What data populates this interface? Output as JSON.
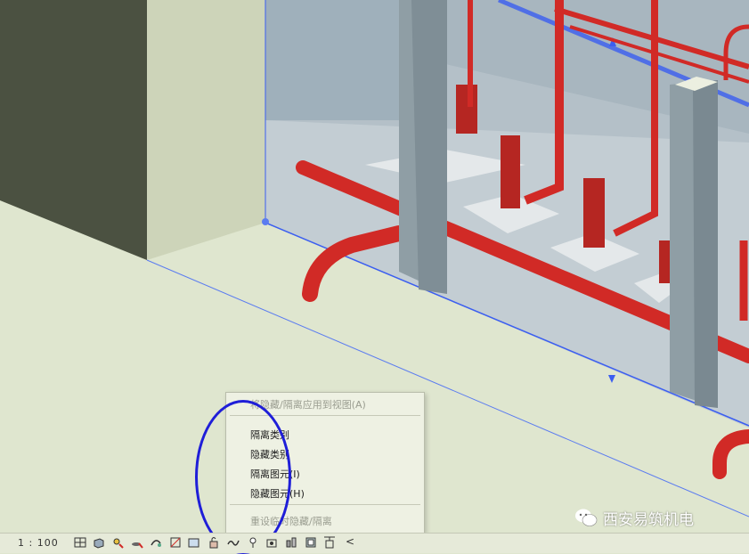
{
  "context_menu": {
    "items": [
      {
        "label": "将隐藏/隔离应用到视图(A)",
        "enabled": false
      },
      {
        "label": "隔离类别",
        "enabled": true
      },
      {
        "label": "隐藏类别",
        "enabled": true
      },
      {
        "label": "隔离图元(I)",
        "enabled": true
      },
      {
        "label": "隐藏图元(H)",
        "enabled": true
      },
      {
        "label": "重设临时隐藏/隔离",
        "enabled": false
      }
    ]
  },
  "status_bar": {
    "scale": "1 : 100",
    "chevron": "<",
    "icons": [
      "detail-level-icon",
      "visual-style-icon",
      "sun-path-off-icon",
      "shadows-off-icon",
      "render-icon",
      "crop-view-icon",
      "show-crop-icon",
      "unlock-3d-icon",
      "temporary-hide-isolate-icon",
      "reveal-hidden-icon",
      "pin-icon",
      "worksharing-icon",
      "analysis-display-icon",
      "highlight-displacement-icon",
      "design-options-icon",
      "constraints-icon"
    ]
  },
  "watermark": {
    "text": "西安易筑机电"
  },
  "colors": {
    "pipe": "#d12a26",
    "selection": "#3b5ef0",
    "annotation": "#1f1ed8",
    "slab": "#dfe6cf"
  }
}
